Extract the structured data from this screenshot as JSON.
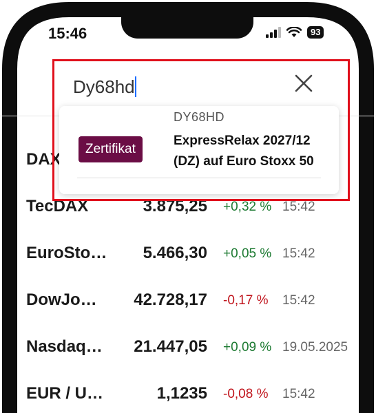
{
  "status_bar": {
    "time": "15:46",
    "battery": "93"
  },
  "search": {
    "value": "Dy68hd"
  },
  "suggestion": {
    "badge": "Zertifikat",
    "code": "DY68HD",
    "name": "ExpressRelax 2027/12 (DZ) auf Euro Stoxx 50"
  },
  "markets": [
    {
      "name": "DAX",
      "value": "",
      "change": "",
      "time": ""
    },
    {
      "name": "TecDAX",
      "value": "3.875,25",
      "change": "+0,32 %",
      "time": "15:42"
    },
    {
      "name": "EuroSto…",
      "value": "5.466,30",
      "change": "+0,05 %",
      "time": "15:42"
    },
    {
      "name": "DowJo…",
      "value": "42.728,17",
      "change": "-0,17 %",
      "time": "15:42"
    },
    {
      "name": "Nasdaq…",
      "value": "21.447,05",
      "change": "+0,09 %",
      "time": "19.05.2025"
    },
    {
      "name": "EUR / U…",
      "value": "1,1235",
      "change": "-0,08 %",
      "time": "15:42"
    }
  ],
  "colors": {
    "badge": "#6b0d45",
    "positive": "#1d7a32",
    "negative": "#c0141c",
    "highlight": "#e0101c"
  }
}
